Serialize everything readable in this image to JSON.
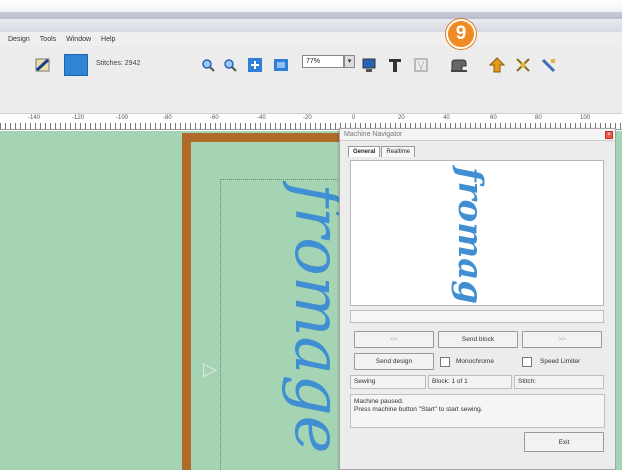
{
  "menu": [
    "Design",
    "Tools",
    "Window",
    "Help"
  ],
  "toolbar": {
    "stitches_label": "Stitches: 2942",
    "swatch_color": "#2f86d6",
    "zoom_value": "77%",
    "icons": [
      "hoop-icon",
      "color-swatch-icon",
      "zoom-in-icon",
      "zoom-out-icon",
      "zoom-fit-icon",
      "zoom-hoop-icon",
      "monitor-icon",
      "text-icon",
      "text-outline-icon",
      "sewing-machine-icon",
      "send-icon",
      "stitch-icon",
      "tool-icon"
    ]
  },
  "badge": "9",
  "ruler_labels": [
    "-140",
    "-120",
    "-100",
    "-80",
    "-60",
    "-40",
    "-20",
    "0",
    "20",
    "40",
    "60",
    "80",
    "100"
  ],
  "design_word": "fromage",
  "navigator": {
    "title": "Machine Navigator",
    "tabs": [
      "General",
      "Realtime"
    ],
    "prev_label": "<<",
    "send_block_label": "Send block",
    "next_label": ">>",
    "send_design_label": "Send design",
    "monochrome_label": "Monochrome",
    "speed_limiter_label": "Speed Limiter",
    "status_sewing": "Sewing",
    "status_block": "Block: 1 of 1",
    "status_stitch": "Stitch:",
    "message_line1": "Machine paused.",
    "message_line2": "Press machine button \"Start\" to start sewing.",
    "exit_label": "Exit"
  }
}
